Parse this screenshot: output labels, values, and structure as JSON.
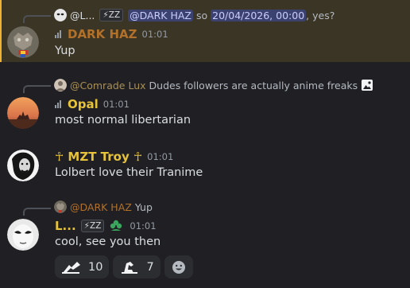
{
  "colors": {
    "highlight_bg": "#3b3526",
    "mention_bg": "#3c4270",
    "name_gold": "#f0b232",
    "name_brown": "#b1712b",
    "name_olive": "#a98f54",
    "name_yellow": "#e7c33a"
  },
  "messages": [
    {
      "reply": {
        "author": "@L...",
        "tag": "⚡ZZ",
        "mention": "@DARK HAZ",
        "text_before": "so",
        "datetime": "20/04/2026, 00:00",
        "text_after": ", yes?"
      },
      "author": "DARK HAZ",
      "time": "01:01",
      "text": "Yup"
    },
    {
      "reply": {
        "author": "@Comrade Lux",
        "text": "Dudes followers are actually anime freaks",
        "attachment_icon": "image-icon"
      },
      "author": "Opal",
      "time": "01:01",
      "text": "most normal libertarian"
    },
    {
      "author": "☥ MZT Troy ☥",
      "time": "01:01",
      "text": "Lolbert love their Tranime"
    },
    {
      "reply": {
        "author": "@DARK HAZ",
        "text": "Yup"
      },
      "author": "L...",
      "tag": "⚡ZZ",
      "time": "01:01",
      "text": "cool, see you then"
    }
  ],
  "reactions": [
    {
      "icon": "custom-emoji-1",
      "count": "10"
    },
    {
      "icon": "custom-emoji-2",
      "count": "7"
    },
    {
      "icon": "add-reaction-icon"
    }
  ]
}
